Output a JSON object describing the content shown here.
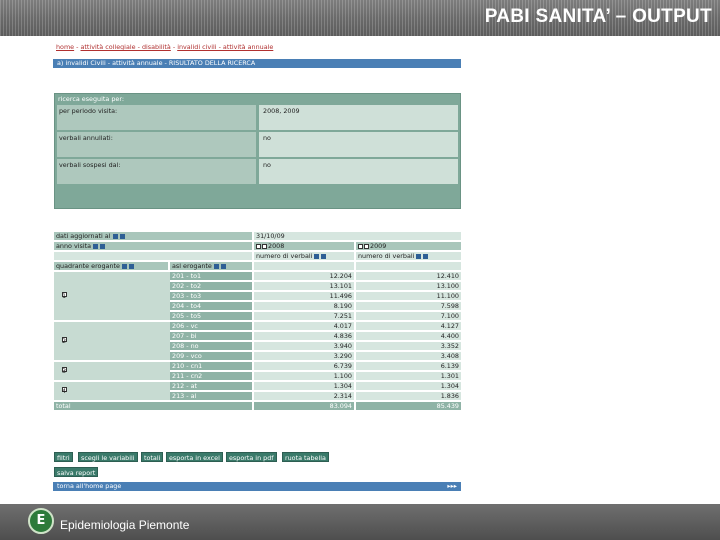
{
  "slide": {
    "title": "PABI SANITA’ – OUTPUT",
    "footer": "Epidemiologia Piemonte",
    "logo_text": "E"
  },
  "screen": {
    "breadcrumb": [
      "home",
      "attività collegiale - disabilità",
      "invalidi civili - attività annuale"
    ],
    "result_title": "a) invalidi Civili - attività annuale - RISULTATO DELLA RICERCA",
    "filters": {
      "header": "ricerca eseguita per:",
      "rows": [
        {
          "label": "per periodo visita:",
          "value": "2008, 2009"
        },
        {
          "label": "verbali annullati:",
          "value": "no"
        },
        {
          "label": "verbali sospesi dal:",
          "value": "no"
        }
      ]
    },
    "table": {
      "updated_label": "dati aggiornati al",
      "updated_value": "31/10/09",
      "year_label": "anno visita",
      "years": [
        "2008",
        "2009"
      ],
      "col_header": "numero di verbali",
      "dim1_label": "quadrante erogante",
      "dim2_label": "asl erogante",
      "groups": [
        {
          "label": "1",
          "rows": [
            {
              "asl": "201 - to1",
              "v2008": "12.204",
              "v2009": "12.410"
            },
            {
              "asl": "202 - to2",
              "v2008": "13.101",
              "v2009": "13.100"
            },
            {
              "asl": "203 - to3",
              "v2008": "11.496",
              "v2009": "11.100"
            },
            {
              "asl": "204 - to4",
              "v2008": "8.190",
              "v2009": "7.598"
            },
            {
              "asl": "205 - to5",
              "v2008": "7.251",
              "v2009": "7.100"
            }
          ]
        },
        {
          "label": "2",
          "rows": [
            {
              "asl": "206 - vc",
              "v2008": "4.017",
              "v2009": "4.127"
            },
            {
              "asl": "207 - bi",
              "v2008": "4.836",
              "v2009": "4.400"
            },
            {
              "asl": "208 - no",
              "v2008": "3.940",
              "v2009": "3.352"
            },
            {
              "asl": "209 - vco",
              "v2008": "3.290",
              "v2009": "3.408"
            }
          ]
        },
        {
          "label": "3",
          "rows": [
            {
              "asl": "210 - cn1",
              "v2008": "6.739",
              "v2009": "6.139"
            },
            {
              "asl": "211 - cn2",
              "v2008": "1.100",
              "v2009": "1.301"
            }
          ]
        },
        {
          "label": "4",
          "rows": [
            {
              "asl": "212 - at",
              "v2008": "1.304",
              "v2009": "1.304"
            },
            {
              "asl": "213 - al",
              "v2008": "2.314",
              "v2009": "1.836"
            }
          ]
        }
      ],
      "total_label": "total",
      "total_2008": "83.094",
      "total_2009": "85.439"
    },
    "buttons": [
      "filtri",
      "scegli le variabili",
      "totali",
      "esporta in excel",
      "esporta in pdf",
      "ruota tabella",
      "salva report"
    ],
    "bottom_link": "torna all'home page",
    "bottom_arrows": "▸▸▸"
  }
}
